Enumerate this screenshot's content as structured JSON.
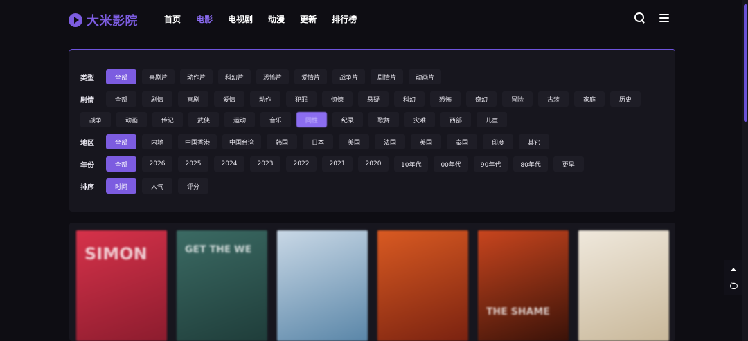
{
  "brand": {
    "name": "大米影院",
    "color": "#7c5ce0"
  },
  "nav": [
    {
      "label": "首页",
      "active": false
    },
    {
      "label": "电影",
      "active": true
    },
    {
      "label": "电视剧",
      "active": false
    },
    {
      "label": "动漫",
      "active": false
    },
    {
      "label": "更新",
      "active": false
    },
    {
      "label": "排行榜",
      "active": false
    }
  ],
  "header_icons": [
    "search-icon",
    "menu-icon"
  ],
  "filters": {
    "type": {
      "label": "类型",
      "options": [
        "全部",
        "喜剧片",
        "动作片",
        "科幻片",
        "恐怖片",
        "爱情片",
        "战争片",
        "剧情片",
        "动画片"
      ],
      "selected": "全部"
    },
    "plot": {
      "label": "剧情",
      "options_row1": [
        "全部",
        "剧情",
        "喜剧",
        "爱情",
        "动作",
        "犯罪",
        "惊悚",
        "悬疑",
        "科幻",
        "恐怖",
        "奇幻",
        "冒险",
        "古装",
        "家庭",
        "历史"
      ],
      "options_row2": [
        "战争",
        "动画",
        "传记",
        "武侠",
        "运动",
        "音乐",
        "同性",
        "纪录",
        "歌舞",
        "灾难",
        "西部",
        "儿童"
      ],
      "selected": "同性"
    },
    "region": {
      "label": "地区",
      "options": [
        "全部",
        "内地",
        "中国香港",
        "中国台湾",
        "韩国",
        "日本",
        "美国",
        "法国",
        "英国",
        "泰国",
        "印度",
        "其它"
      ],
      "selected": "全部"
    },
    "year": {
      "label": "年份",
      "options": [
        "全部",
        "2026",
        "2025",
        "2024",
        "2023",
        "2022",
        "2021",
        "2020",
        "10年代",
        "00年代",
        "90年代",
        "80年代",
        "更早"
      ],
      "selected": "全部"
    },
    "sort": {
      "label": "排序",
      "options": [
        "时间",
        "人气",
        "评分"
      ],
      "selected": "时间"
    }
  },
  "posters": [
    {
      "title_text": "SIMON",
      "colors": [
        "#d6324a",
        "#8c1c2e"
      ]
    },
    {
      "title_text": "GET THE WE",
      "colors": [
        "#3b6a63",
        "#1f3d3a"
      ]
    },
    {
      "title_text": "",
      "colors": [
        "#c9d8e6",
        "#5a86a8"
      ]
    },
    {
      "title_text": "",
      "colors": [
        "#d95a22",
        "#7a2210"
      ]
    },
    {
      "title_text": "THE SHAME",
      "colors": [
        "#c8451e",
        "#3a1208"
      ]
    },
    {
      "title_text": "",
      "colors": [
        "#efe8dc",
        "#c9b89a"
      ]
    }
  ],
  "float_buttons": [
    "up-arrow-icon",
    "chat-icon"
  ]
}
